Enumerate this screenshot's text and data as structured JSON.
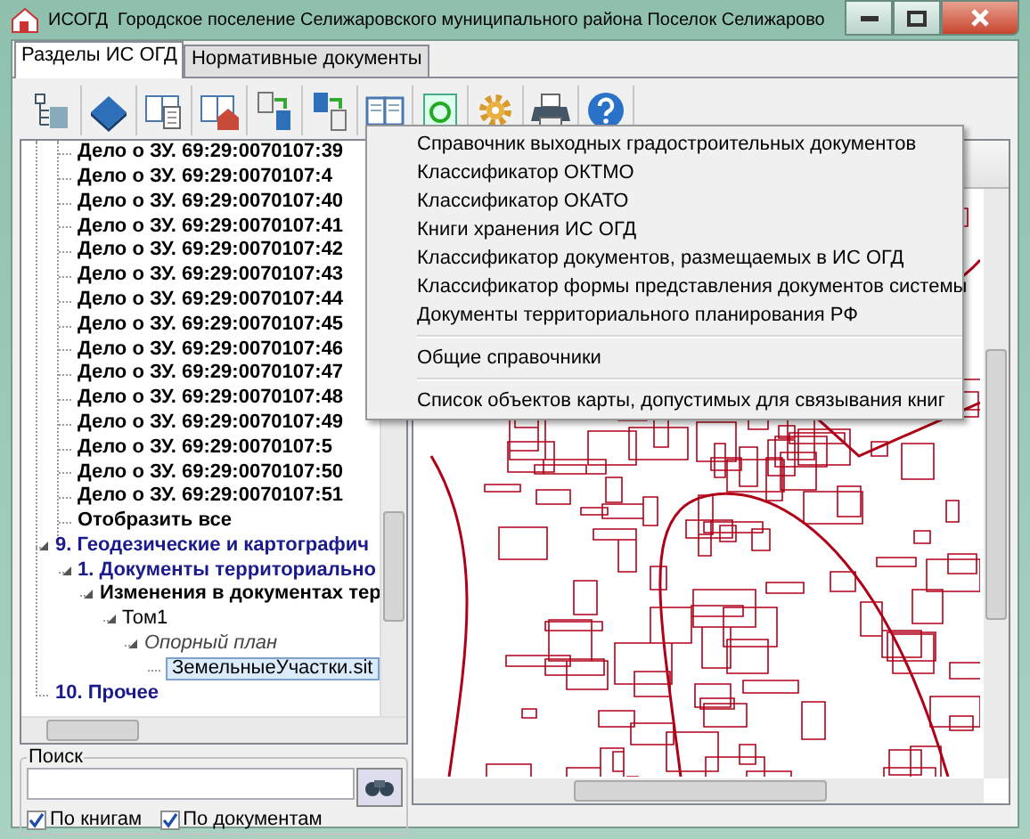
{
  "window": {
    "title": "ИСОГД  Городское поселение Селижаровского муниципального района Поселок Селижарово"
  },
  "tabs": [
    {
      "label": "Разделы ИС ОГД",
      "selected": true
    },
    {
      "label": "Нормативные документы",
      "selected": false
    }
  ],
  "tree": {
    "items": [
      {
        "kind": "hidden",
        "children": [
          {
            "kind": "case",
            "label": "Дело о ЗУ. 69:29:0070107:39"
          },
          {
            "kind": "case",
            "label": "Дело о ЗУ. 69:29:0070107:4"
          },
          {
            "kind": "case",
            "label": "Дело о ЗУ. 69:29:0070107:40"
          },
          {
            "kind": "case",
            "label": "Дело о ЗУ. 69:29:0070107:41"
          },
          {
            "kind": "case",
            "label": "Дело о ЗУ. 69:29:0070107:42"
          },
          {
            "kind": "case",
            "label": "Дело о ЗУ. 69:29:0070107:43"
          },
          {
            "kind": "case",
            "label": "Дело о ЗУ. 69:29:0070107:44"
          },
          {
            "kind": "case",
            "label": "Дело о ЗУ. 69:29:0070107:45"
          },
          {
            "kind": "case",
            "label": "Дело о ЗУ. 69:29:0070107:46"
          },
          {
            "kind": "case",
            "label": "Дело о ЗУ. 69:29:0070107:47"
          },
          {
            "kind": "case",
            "label": "Дело о ЗУ. 69:29:0070107:48"
          },
          {
            "kind": "case",
            "label": "Дело о ЗУ. 69:29:0070107:49"
          },
          {
            "kind": "case",
            "label": "Дело о ЗУ. 69:29:0070107:5"
          },
          {
            "kind": "case",
            "label": "Дело о ЗУ. 69:29:0070107:50"
          },
          {
            "kind": "case",
            "label": "Дело о ЗУ. 69:29:0070107:51"
          },
          {
            "kind": "case",
            "label": "Отобразить все"
          }
        ]
      },
      {
        "kind": "section",
        "label": "9. Геодезические и картографич",
        "expanded": true,
        "children": [
          {
            "kind": "section",
            "label": "1. Документы территориально",
            "expanded": true,
            "children": [
              {
                "kind": "case",
                "label": "Изменения в документах тер",
                "expanded": true,
                "children": [
                  {
                    "kind": "volume",
                    "label": "Том1",
                    "expanded": true,
                    "children": [
                      {
                        "kind": "plan",
                        "label": "Опорный план",
                        "expanded": true,
                        "children": [
                          {
                            "kind": "file",
                            "label": "ЗемельныеУчастки.sit",
                            "selected": true
                          }
                        ]
                      }
                    ]
                  }
                ]
              }
            ]
          }
        ]
      },
      {
        "kind": "section",
        "label": "10. Прочее"
      }
    ]
  },
  "search": {
    "label": "Поиск",
    "options": [
      {
        "label": "По книгам",
        "checked": true
      },
      {
        "label": "По документам",
        "checked": true
      }
    ]
  },
  "menu": {
    "items": [
      {
        "kind": "item",
        "label": "Справочник выходных градостроительных документов"
      },
      {
        "kind": "item",
        "label": "Классификатор ОКТМО"
      },
      {
        "kind": "item",
        "label": "Классификатор ОКАТО"
      },
      {
        "kind": "item",
        "label": "Книги хранения ИС ОГД"
      },
      {
        "kind": "item",
        "label": "Классификатор документов, размещаемых в ИС ОГД"
      },
      {
        "kind": "item",
        "label": "Классификатор формы представления документов системы"
      },
      {
        "kind": "item",
        "label": "Документы территориального планирования РФ"
      },
      {
        "kind": "separator"
      },
      {
        "kind": "item",
        "label": "Общие справочники"
      },
      {
        "kind": "separator"
      },
      {
        "kind": "item",
        "label": "Список объектов карты, допустимых для связывания книг"
      }
    ]
  }
}
